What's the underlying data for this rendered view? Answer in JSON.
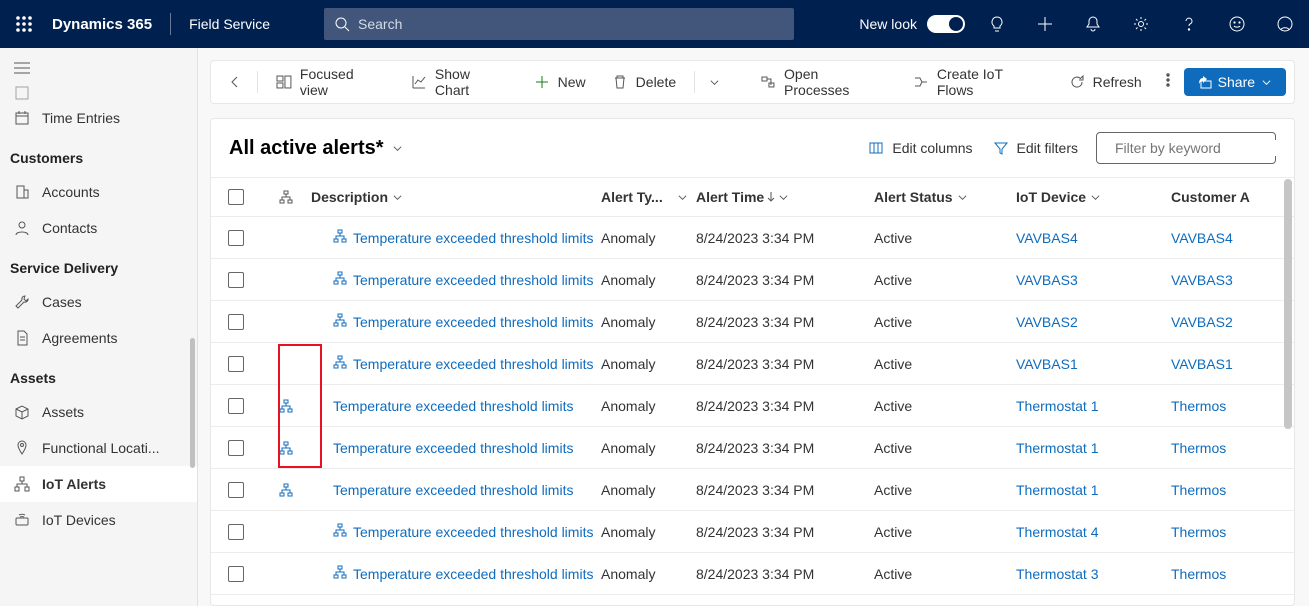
{
  "header": {
    "brand": "Dynamics 365",
    "module": "Field Service",
    "search_placeholder": "Search",
    "newlook": "New look"
  },
  "sidebar": {
    "cut_item": "",
    "item_time_entries": "Time Entries",
    "section_customers": "Customers",
    "item_accounts": "Accounts",
    "item_contacts": "Contacts",
    "section_service_delivery": "Service Delivery",
    "item_cases": "Cases",
    "item_agreements": "Agreements",
    "section_assets": "Assets",
    "item_assets": "Assets",
    "item_functional": "Functional Locati...",
    "item_iot_alerts": "IoT Alerts",
    "item_iot_devices": "IoT Devices"
  },
  "commands": {
    "focused_view": "Focused view",
    "show_chart": "Show Chart",
    "new": "New",
    "delete": "Delete",
    "open_processes": "Open Processes",
    "create_iot_flows": "Create IoT Flows",
    "refresh": "Refresh",
    "share": "Share"
  },
  "view": {
    "name": "All active alerts*",
    "edit_columns": "Edit columns",
    "edit_filters": "Edit filters",
    "filter_placeholder": "Filter by keyword"
  },
  "columns": {
    "description": "Description",
    "alert_type": "Alert Ty...",
    "alert_time": "Alert Time",
    "alert_status": "Alert Status",
    "iot_device": "IoT Device",
    "customer": "Customer A"
  },
  "rows": [
    {
      "hier_col": false,
      "desc_icon": true,
      "desc": "Temperature exceeded threshold limits",
      "type": "Anomaly",
      "time": "8/24/2023 3:34 PM",
      "status": "Active",
      "device": "VAVBAS4",
      "asset": "VAVBAS4"
    },
    {
      "hier_col": false,
      "desc_icon": true,
      "desc": "Temperature exceeded threshold limits",
      "type": "Anomaly",
      "time": "8/24/2023 3:34 PM",
      "status": "Active",
      "device": "VAVBAS3",
      "asset": "VAVBAS3"
    },
    {
      "hier_col": false,
      "desc_icon": true,
      "desc": "Temperature exceeded threshold limits",
      "type": "Anomaly",
      "time": "8/24/2023 3:34 PM",
      "status": "Active",
      "device": "VAVBAS2",
      "asset": "VAVBAS2"
    },
    {
      "hier_col": false,
      "desc_icon": true,
      "desc": "Temperature exceeded threshold limits",
      "type": "Anomaly",
      "time": "8/24/2023 3:34 PM",
      "status": "Active",
      "device": "VAVBAS1",
      "asset": "VAVBAS1"
    },
    {
      "hier_col": true,
      "desc_icon": false,
      "desc": "Temperature exceeded threshold limits",
      "type": "Anomaly",
      "time": "8/24/2023 3:34 PM",
      "status": "Active",
      "device": "Thermostat 1",
      "asset": "Thermos"
    },
    {
      "hier_col": true,
      "desc_icon": false,
      "desc": "Temperature exceeded threshold limits",
      "type": "Anomaly",
      "time": "8/24/2023 3:34 PM",
      "status": "Active",
      "device": "Thermostat 1",
      "asset": "Thermos"
    },
    {
      "hier_col": true,
      "desc_icon": false,
      "desc": "Temperature exceeded threshold limits",
      "type": "Anomaly",
      "time": "8/24/2023 3:34 PM",
      "status": "Active",
      "device": "Thermostat 1",
      "asset": "Thermos"
    },
    {
      "hier_col": false,
      "desc_icon": true,
      "desc": "Temperature exceeded threshold limits",
      "type": "Anomaly",
      "time": "8/24/2023 3:34 PM",
      "status": "Active",
      "device": "Thermostat 4",
      "asset": "Thermos"
    },
    {
      "hier_col": false,
      "desc_icon": true,
      "desc": "Temperature exceeded threshold limits",
      "type": "Anomaly",
      "time": "8/24/2023 3:34 PM",
      "status": "Active",
      "device": "Thermostat 3",
      "asset": "Thermos"
    }
  ]
}
